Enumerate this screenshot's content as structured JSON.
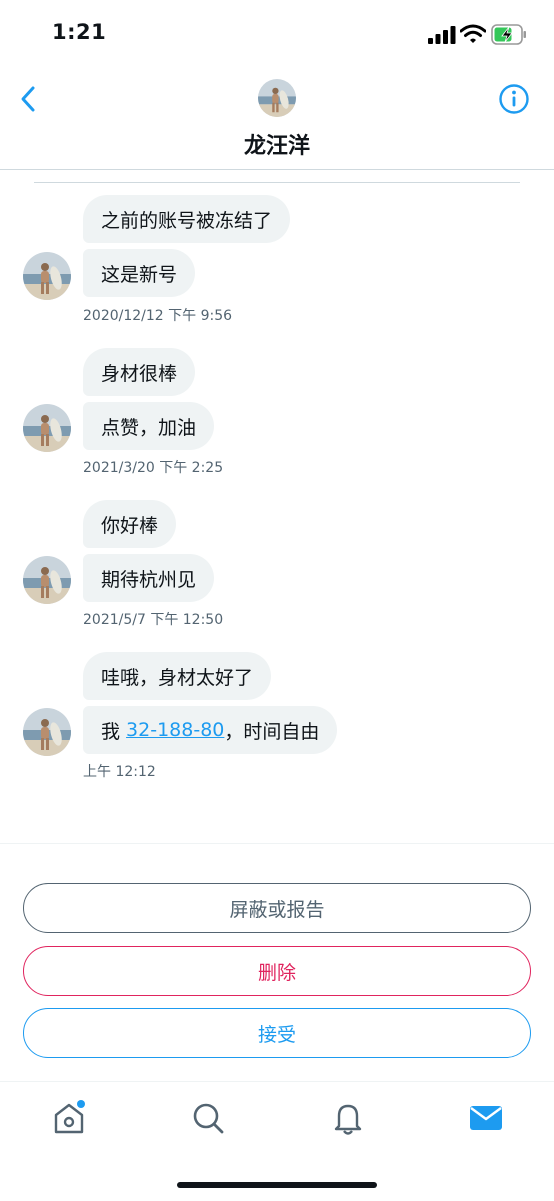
{
  "status_bar": {
    "time": "1:21"
  },
  "header": {
    "title": "龙汪洋"
  },
  "messages": [
    {
      "bubbles": [
        "之前的账号被冻结了",
        "这是新号"
      ],
      "timestamp": "2020/12/12 下午 9:56"
    },
    {
      "bubbles": [
        "身材很棒",
        "点赞，加油"
      ],
      "timestamp": "2021/3/20 下午 2:25"
    },
    {
      "bubbles": [
        "你好棒",
        "期待杭州见"
      ],
      "timestamp": "2021/5/7 下午 12:50"
    },
    {
      "bubbles": [
        "哇哦，身材太好了"
      ],
      "timestamp": "上午 12:12",
      "phone_message": {
        "prefix": "我 ",
        "phone": "32-188-80",
        "suffix": "，时间自由"
      }
    }
  ],
  "actions": {
    "block_label": "屏蔽或报告",
    "delete_label": "删除",
    "accept_label": "接受"
  },
  "colors": {
    "accent": "#1d9bf0",
    "danger": "#e0245e",
    "muted": "#536471",
    "bubble": "#eff3f4"
  },
  "tab_bar": {
    "icons": [
      "home-icon",
      "search-icon",
      "notifications-icon",
      "messages-icon"
    ],
    "home_has_badge": true
  }
}
